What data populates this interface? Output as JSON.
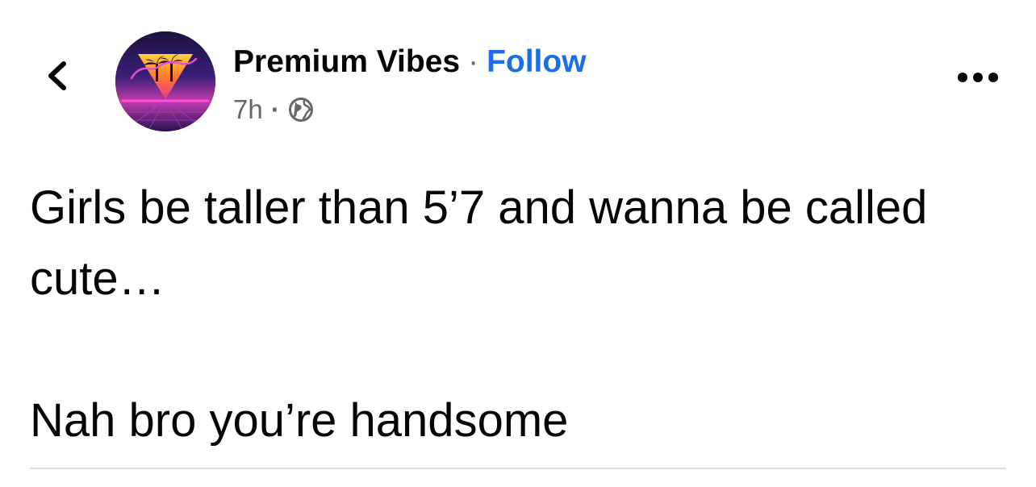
{
  "header": {
    "back_icon": "chevron-left-icon",
    "avatar_icon": "page-avatar-retro-sunset",
    "page_name": "Premium Vibes",
    "separator": "·",
    "follow_label": "Follow",
    "more_icon": "more-horizontal-icon"
  },
  "meta": {
    "time": "7h",
    "separator": "·",
    "audience_icon": "globe-icon"
  },
  "post": {
    "paragraphs": [
      "Girls be taller than 5’7 and wanna be called cute…",
      "Nah bro you’re handsome"
    ]
  },
  "colors": {
    "follow": "#1b6ee8",
    "text": "#050505",
    "secondary": "#65676b",
    "divider": "#dadde1"
  }
}
